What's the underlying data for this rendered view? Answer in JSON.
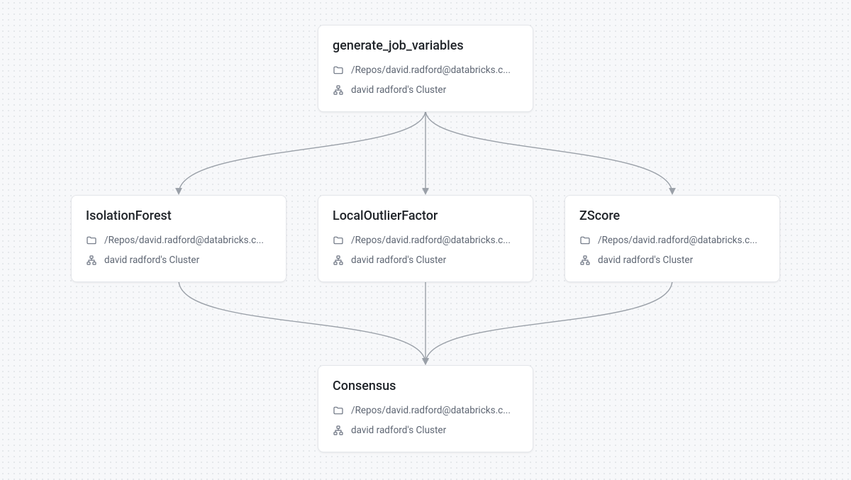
{
  "common": {
    "repo_path": "/Repos/david.radford@databricks.c...",
    "cluster": "david radford's Cluster"
  },
  "nodes": {
    "top": {
      "title": "generate_job_variables"
    },
    "left": {
      "title": "IsolationForest"
    },
    "mid": {
      "title": "LocalOutlierFactor"
    },
    "right": {
      "title": "ZScore"
    },
    "bottom": {
      "title": "Consensus"
    }
  }
}
